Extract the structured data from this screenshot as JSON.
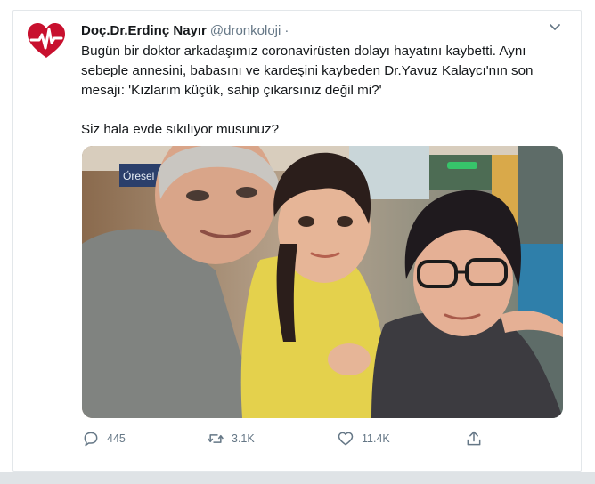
{
  "tweet": {
    "author_name": "Doç.Dr.Erdinç Nayır",
    "author_handle": "@dronkoloji",
    "separator": "·",
    "text_paragraph_1": "Bugün bir doktor arkadaşımız coronavirüsten dolayı hayatını kaybetti. Aynı sebeple annesini, babasını ve kardeşini kaybeden Dr.Yavuz Kalaycı'nın son mesajı: 'Kızlarım küçük, sahip çıkarsınız değil mi?'",
    "text_paragraph_2": "Siz hala evde sıkılıyor musunuz?",
    "photo_sign_text": "Öresel",
    "reply_count": "445",
    "retweet_count": "3.1K",
    "like_count": "11.4K"
  },
  "colors": {
    "text": "#14171a",
    "muted": "#657786",
    "avatar_red": "#c8102e"
  },
  "icons": {
    "avatar": "heart-ekg-logo",
    "menu": "chevron-down-icon",
    "reply": "reply-icon",
    "retweet": "retweet-icon",
    "like": "heart-icon",
    "share": "share-icon"
  }
}
